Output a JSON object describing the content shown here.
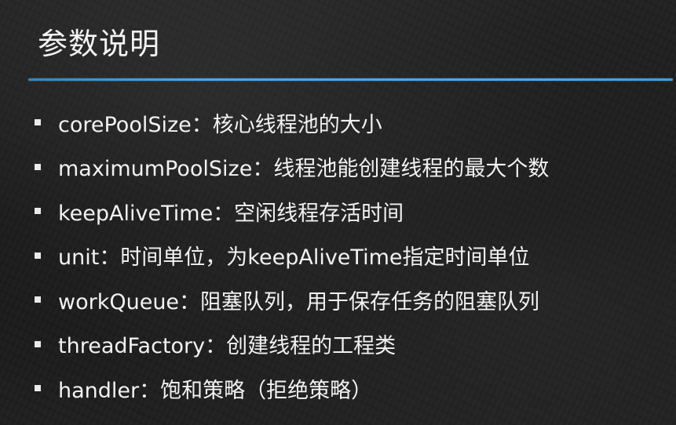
{
  "slide": {
    "title": "参数说明",
    "bullets": [
      "corePoolSize：核心线程池的大小",
      "maximumPoolSize：线程池能创建线程的最大个数",
      "keepAliveTime：空闲线程存活时间",
      "unit：时间单位，为keepAliveTime指定时间单位",
      "workQueue：阻塞队列，用于保存任务的阻塞队列",
      "threadFactory：创建线程的工程类",
      "handler：饱和策略（拒绝策略）"
    ]
  },
  "colors": {
    "background": "#1c1c1c",
    "text": "#f2f2f2",
    "rule": "#4aa9ea"
  },
  "icons": {
    "bullet": "square-bullet-icon"
  }
}
